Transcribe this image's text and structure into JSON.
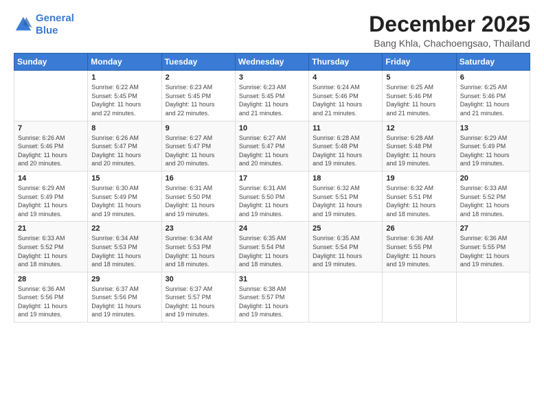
{
  "logo": {
    "line1": "General",
    "line2": "Blue"
  },
  "title": "December 2025",
  "subtitle": "Bang Khla, Chachoengsao, Thailand",
  "days_of_week": [
    "Sunday",
    "Monday",
    "Tuesday",
    "Wednesday",
    "Thursday",
    "Friday",
    "Saturday"
  ],
  "weeks": [
    [
      {
        "day": "",
        "info": ""
      },
      {
        "day": "1",
        "info": "Sunrise: 6:22 AM\nSunset: 5:45 PM\nDaylight: 11 hours\nand 22 minutes."
      },
      {
        "day": "2",
        "info": "Sunrise: 6:23 AM\nSunset: 5:45 PM\nDaylight: 11 hours\nand 22 minutes."
      },
      {
        "day": "3",
        "info": "Sunrise: 6:23 AM\nSunset: 5:45 PM\nDaylight: 11 hours\nand 21 minutes."
      },
      {
        "day": "4",
        "info": "Sunrise: 6:24 AM\nSunset: 5:46 PM\nDaylight: 11 hours\nand 21 minutes."
      },
      {
        "day": "5",
        "info": "Sunrise: 6:25 AM\nSunset: 5:46 PM\nDaylight: 11 hours\nand 21 minutes."
      },
      {
        "day": "6",
        "info": "Sunrise: 6:25 AM\nSunset: 5:46 PM\nDaylight: 11 hours\nand 21 minutes."
      }
    ],
    [
      {
        "day": "7",
        "info": "Sunrise: 6:26 AM\nSunset: 5:46 PM\nDaylight: 11 hours\nand 20 minutes."
      },
      {
        "day": "8",
        "info": "Sunrise: 6:26 AM\nSunset: 5:47 PM\nDaylight: 11 hours\nand 20 minutes."
      },
      {
        "day": "9",
        "info": "Sunrise: 6:27 AM\nSunset: 5:47 PM\nDaylight: 11 hours\nand 20 minutes."
      },
      {
        "day": "10",
        "info": "Sunrise: 6:27 AM\nSunset: 5:47 PM\nDaylight: 11 hours\nand 20 minutes."
      },
      {
        "day": "11",
        "info": "Sunrise: 6:28 AM\nSunset: 5:48 PM\nDaylight: 11 hours\nand 19 minutes."
      },
      {
        "day": "12",
        "info": "Sunrise: 6:28 AM\nSunset: 5:48 PM\nDaylight: 11 hours\nand 19 minutes."
      },
      {
        "day": "13",
        "info": "Sunrise: 6:29 AM\nSunset: 5:49 PM\nDaylight: 11 hours\nand 19 minutes."
      }
    ],
    [
      {
        "day": "14",
        "info": "Sunrise: 6:29 AM\nSunset: 5:49 PM\nDaylight: 11 hours\nand 19 minutes."
      },
      {
        "day": "15",
        "info": "Sunrise: 6:30 AM\nSunset: 5:49 PM\nDaylight: 11 hours\nand 19 minutes."
      },
      {
        "day": "16",
        "info": "Sunrise: 6:31 AM\nSunset: 5:50 PM\nDaylight: 11 hours\nand 19 minutes."
      },
      {
        "day": "17",
        "info": "Sunrise: 6:31 AM\nSunset: 5:50 PM\nDaylight: 11 hours\nand 19 minutes."
      },
      {
        "day": "18",
        "info": "Sunrise: 6:32 AM\nSunset: 5:51 PM\nDaylight: 11 hours\nand 19 minutes."
      },
      {
        "day": "19",
        "info": "Sunrise: 6:32 AM\nSunset: 5:51 PM\nDaylight: 11 hours\nand 18 minutes."
      },
      {
        "day": "20",
        "info": "Sunrise: 6:33 AM\nSunset: 5:52 PM\nDaylight: 11 hours\nand 18 minutes."
      }
    ],
    [
      {
        "day": "21",
        "info": "Sunrise: 6:33 AM\nSunset: 5:52 PM\nDaylight: 11 hours\nand 18 minutes."
      },
      {
        "day": "22",
        "info": "Sunrise: 6:34 AM\nSunset: 5:53 PM\nDaylight: 11 hours\nand 18 minutes."
      },
      {
        "day": "23",
        "info": "Sunrise: 6:34 AM\nSunset: 5:53 PM\nDaylight: 11 hours\nand 18 minutes."
      },
      {
        "day": "24",
        "info": "Sunrise: 6:35 AM\nSunset: 5:54 PM\nDaylight: 11 hours\nand 18 minutes."
      },
      {
        "day": "25",
        "info": "Sunrise: 6:35 AM\nSunset: 5:54 PM\nDaylight: 11 hours\nand 19 minutes."
      },
      {
        "day": "26",
        "info": "Sunrise: 6:36 AM\nSunset: 5:55 PM\nDaylight: 11 hours\nand 19 minutes."
      },
      {
        "day": "27",
        "info": "Sunrise: 6:36 AM\nSunset: 5:55 PM\nDaylight: 11 hours\nand 19 minutes."
      }
    ],
    [
      {
        "day": "28",
        "info": "Sunrise: 6:36 AM\nSunset: 5:56 PM\nDaylight: 11 hours\nand 19 minutes."
      },
      {
        "day": "29",
        "info": "Sunrise: 6:37 AM\nSunset: 5:56 PM\nDaylight: 11 hours\nand 19 minutes."
      },
      {
        "day": "30",
        "info": "Sunrise: 6:37 AM\nSunset: 5:57 PM\nDaylight: 11 hours\nand 19 minutes."
      },
      {
        "day": "31",
        "info": "Sunrise: 6:38 AM\nSunset: 5:57 PM\nDaylight: 11 hours\nand 19 minutes."
      },
      {
        "day": "",
        "info": ""
      },
      {
        "day": "",
        "info": ""
      },
      {
        "day": "",
        "info": ""
      }
    ]
  ]
}
